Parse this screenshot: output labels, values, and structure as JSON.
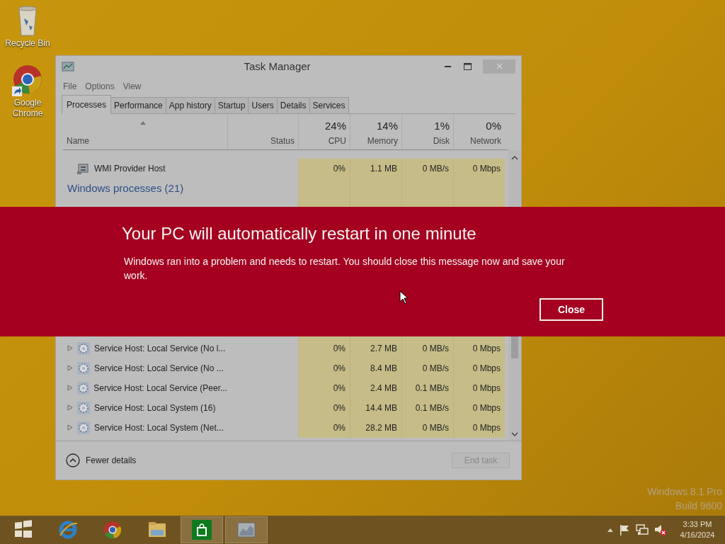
{
  "desktop_icons": [
    {
      "kind": "recycle",
      "label": "Recycle Bin"
    },
    {
      "kind": "browser",
      "label": "Google Chrome"
    }
  ],
  "task_manager": {
    "title": "Task Manager",
    "menu": [
      "File",
      "Options",
      "View"
    ],
    "tabs": [
      {
        "label": "Processes",
        "selected": true
      },
      {
        "label": "Performance",
        "selected": false
      },
      {
        "label": "App history",
        "selected": false
      },
      {
        "label": "Startup",
        "selected": false
      },
      {
        "label": "Users",
        "selected": false
      },
      {
        "label": "Details",
        "selected": false
      },
      {
        "label": "Services",
        "selected": false
      }
    ],
    "columns": [
      {
        "label": "Name",
        "sorted": true
      },
      {
        "label": "Status"
      },
      {
        "label": "CPU",
        "total": "24%"
      },
      {
        "label": "Memory",
        "total": "14%"
      },
      {
        "label": "Disk",
        "total": "1%"
      },
      {
        "label": "Network",
        "total": "0%"
      }
    ],
    "rows": [
      {
        "kind": "process",
        "expandable": false,
        "name": "WMI Provider Host",
        "cpu": "0%",
        "memory": "1.1 MB",
        "disk": "0 MB/s",
        "network": "0 Mbps"
      },
      {
        "kind": "group",
        "name": "Windows processes (21)"
      },
      {
        "kind": "gap"
      },
      {
        "kind": "service",
        "expandable": true,
        "name": "Service Host: Local Service (No l...",
        "cpu": "0%",
        "memory": "2.7 MB",
        "disk": "0 MB/s",
        "network": "0 Mbps"
      },
      {
        "kind": "service",
        "expandable": true,
        "name": "Service Host: Local Service (No ...",
        "cpu": "0%",
        "memory": "8.4 MB",
        "disk": "0 MB/s",
        "network": "0 Mbps"
      },
      {
        "kind": "service",
        "expandable": true,
        "name": "Service Host: Local Service (Peer...",
        "cpu": "0%",
        "memory": "2.4 MB",
        "disk": "0.1 MB/s",
        "network": "0 Mbps"
      },
      {
        "kind": "service",
        "expandable": true,
        "name": "Service Host: Local System (16)",
        "cpu": "0%",
        "memory": "14.4 MB",
        "disk": "0.1 MB/s",
        "network": "0 Mbps"
      },
      {
        "kind": "service",
        "expandable": true,
        "name": "Service Host: Local System (Net...",
        "cpu": "0%",
        "memory": "28.2 MB",
        "disk": "0 MB/s",
        "network": "0 Mbps"
      }
    ],
    "fewer_details": "Fewer details",
    "end_task": {
      "label": "End task",
      "disabled": true
    }
  },
  "banner": {
    "title": "Your PC will automatically restart in one minute",
    "message": "Windows ran into a problem and needs to restart. You should close this message now and save your work.",
    "button": "Close"
  },
  "os_edition": [
    "Windows 8.1 Pro",
    "Build 9600"
  ],
  "taskbar": {
    "apps": [
      {
        "kind": "start",
        "active": false
      },
      {
        "kind": "ie",
        "active": false
      },
      {
        "kind": "browser",
        "active": false
      },
      {
        "kind": "folder",
        "active": false
      },
      {
        "kind": "store",
        "active": true
      },
      {
        "kind": "taskmgr",
        "active": true
      }
    ],
    "tray": {
      "volume_muted": true
    },
    "time": "3:33 PM",
    "date": "4/16/2024"
  }
}
